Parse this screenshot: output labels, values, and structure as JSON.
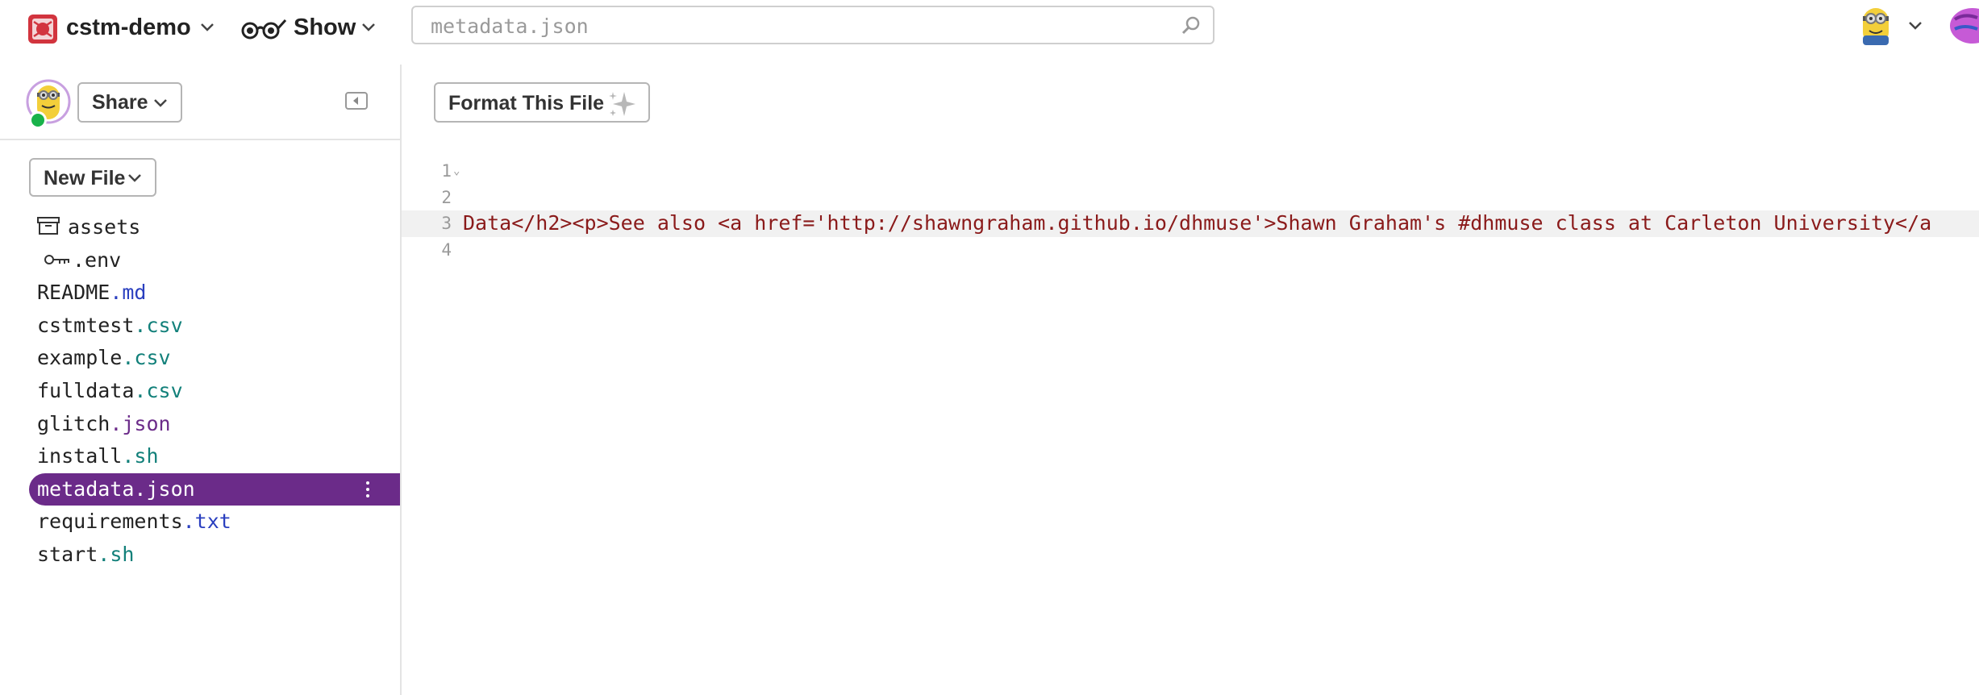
{
  "header": {
    "project_name": "cstm-demo",
    "show_label": "Show",
    "search_placeholder": "metadata.json"
  },
  "sidebar": {
    "share_label": "Share",
    "new_file_label": "New File",
    "files": [
      {
        "name": "assets",
        "ext": "",
        "type": "folder"
      },
      {
        "name": ".env",
        "ext": "",
        "type": "env"
      },
      {
        "name": "README",
        "ext": ".md",
        "ext_color": "#2a3fbf"
      },
      {
        "name": "cstmtest",
        "ext": ".csv",
        "ext_color": "#12807a"
      },
      {
        "name": "example",
        "ext": ".csv",
        "ext_color": "#12807a"
      },
      {
        "name": "fulldata",
        "ext": ".csv",
        "ext_color": "#12807a"
      },
      {
        "name": "glitch",
        "ext": ".json",
        "ext_color": "#6b2b89"
      },
      {
        "name": "install",
        "ext": ".sh",
        "ext_color": "#12807a"
      },
      {
        "name": "metadata",
        "ext": ".json",
        "ext_color": "#ffffff",
        "active": true
      },
      {
        "name": "requirements",
        "ext": ".txt",
        "ext_color": "#2a3fbf"
      },
      {
        "name": "start",
        "ext": ".sh",
        "ext_color": "#12807a"
      }
    ]
  },
  "editor": {
    "format_label": "Format This File",
    "lines": [
      {
        "num": "1",
        "text": ""
      },
      {
        "num": "2",
        "text": ""
      },
      {
        "num": "3",
        "text": "Data</h2><p>See also <a href='http://shawngraham.github.io/dhmuse'>Shawn Graham's #dhmuse class at Carleton University</a"
      },
      {
        "num": "4",
        "text": ""
      }
    ]
  },
  "colors": {
    "accent": "#6b2b89",
    "code_text": "#8a1a1a",
    "online": "#19b24a"
  },
  "icons": [
    "project-logo-icon",
    "glasses-icon",
    "search-icon",
    "avatar-icon",
    "folder-icon",
    "key-icon",
    "sparkle-icon",
    "collapse-icon",
    "kebab-icon"
  ]
}
